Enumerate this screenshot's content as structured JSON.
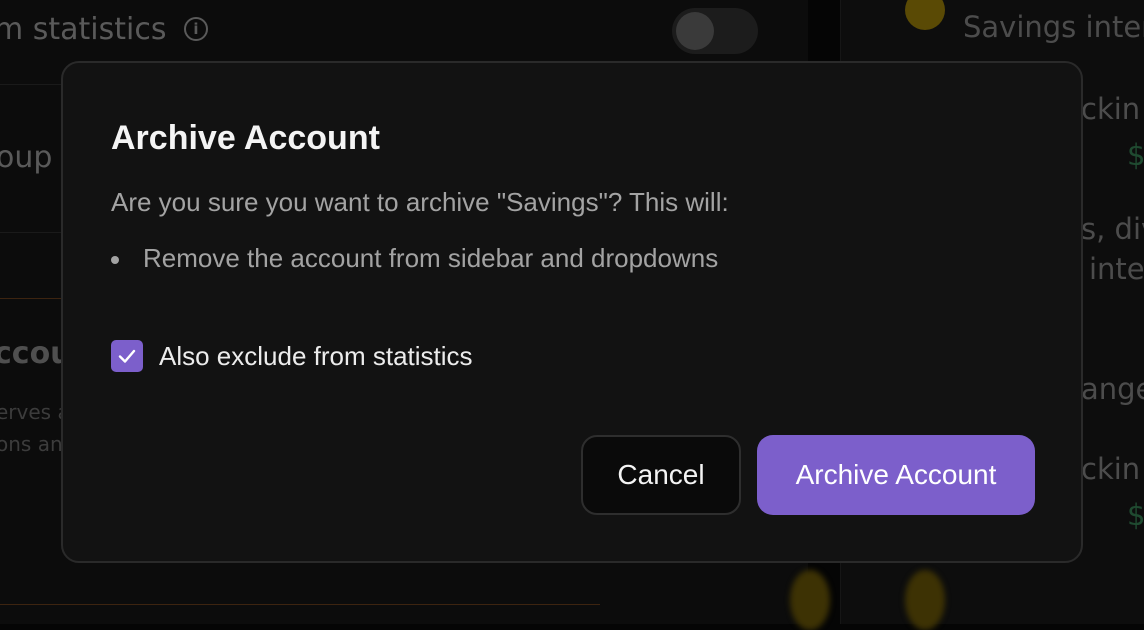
{
  "background": {
    "statistics_title": "m statistics",
    "group_text": "oup",
    "account_text": "ccour",
    "serves_text": "erves a",
    "ons_text": "ons an",
    "right_savings": "Savings inter",
    "right_checking_1": "ckin",
    "right_checking_2": "ckin",
    "right_dollar_1": "$",
    "right_dollar_2": "$",
    "right_s_div": "s, div",
    "right_inter": "inter",
    "right_ange": "ange"
  },
  "modal": {
    "title": "Archive Account",
    "description": "Are you sure you want to archive \"Savings\"? This will:",
    "consequences": [
      "Remove the account from sidebar and dropdowns"
    ],
    "exclude_checkbox": {
      "label": "Also exclude from statistics",
      "checked": true
    },
    "cancel_label": "Cancel",
    "confirm_label": "Archive Account"
  },
  "colors": {
    "accent": "#7c5fcb",
    "modal_bg": "#121212",
    "muted_text": "#a3a3a3"
  }
}
